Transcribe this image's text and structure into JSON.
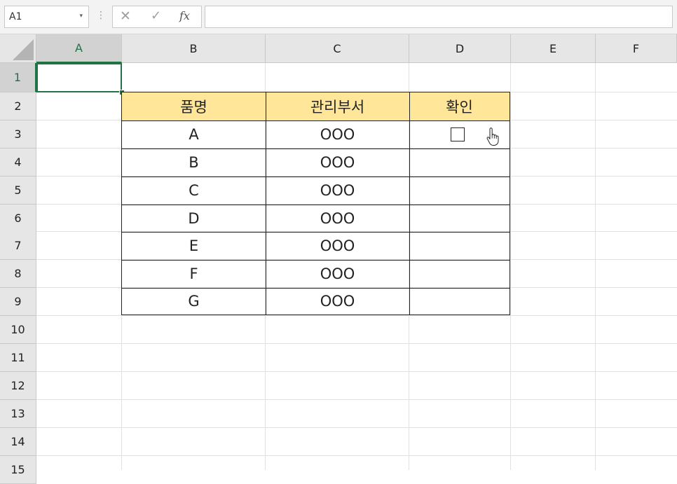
{
  "formula_bar": {
    "name_box": "A1",
    "name_box_arrow": "▾",
    "dots": "⋮",
    "cancel_glyph": "✕",
    "enter_glyph": "✓",
    "fx_label": "fx",
    "formula": ""
  },
  "columns": [
    "A",
    "B",
    "C",
    "D",
    "E",
    "F"
  ],
  "rows": [
    "1",
    "2",
    "3",
    "4",
    "5",
    "6",
    "7",
    "8",
    "9",
    "10",
    "11",
    "12",
    "13",
    "14",
    "15"
  ],
  "table": {
    "headers": [
      "품명",
      "관리부서",
      "확인"
    ],
    "items": [
      {
        "name": "A",
        "dept": "OOO"
      },
      {
        "name": "B",
        "dept": "OOO"
      },
      {
        "name": "C",
        "dept": "OOO"
      },
      {
        "name": "D",
        "dept": "OOO"
      },
      {
        "name": "E",
        "dept": "OOO"
      },
      {
        "name": "F",
        "dept": "OOO"
      },
      {
        "name": "G",
        "dept": "OOO"
      }
    ],
    "header_color": "#ffe699"
  },
  "selection": {
    "accent": "#217346"
  },
  "icons": {
    "checkbox": "checkbox-icon",
    "cursor": "hand-pointer-icon"
  }
}
